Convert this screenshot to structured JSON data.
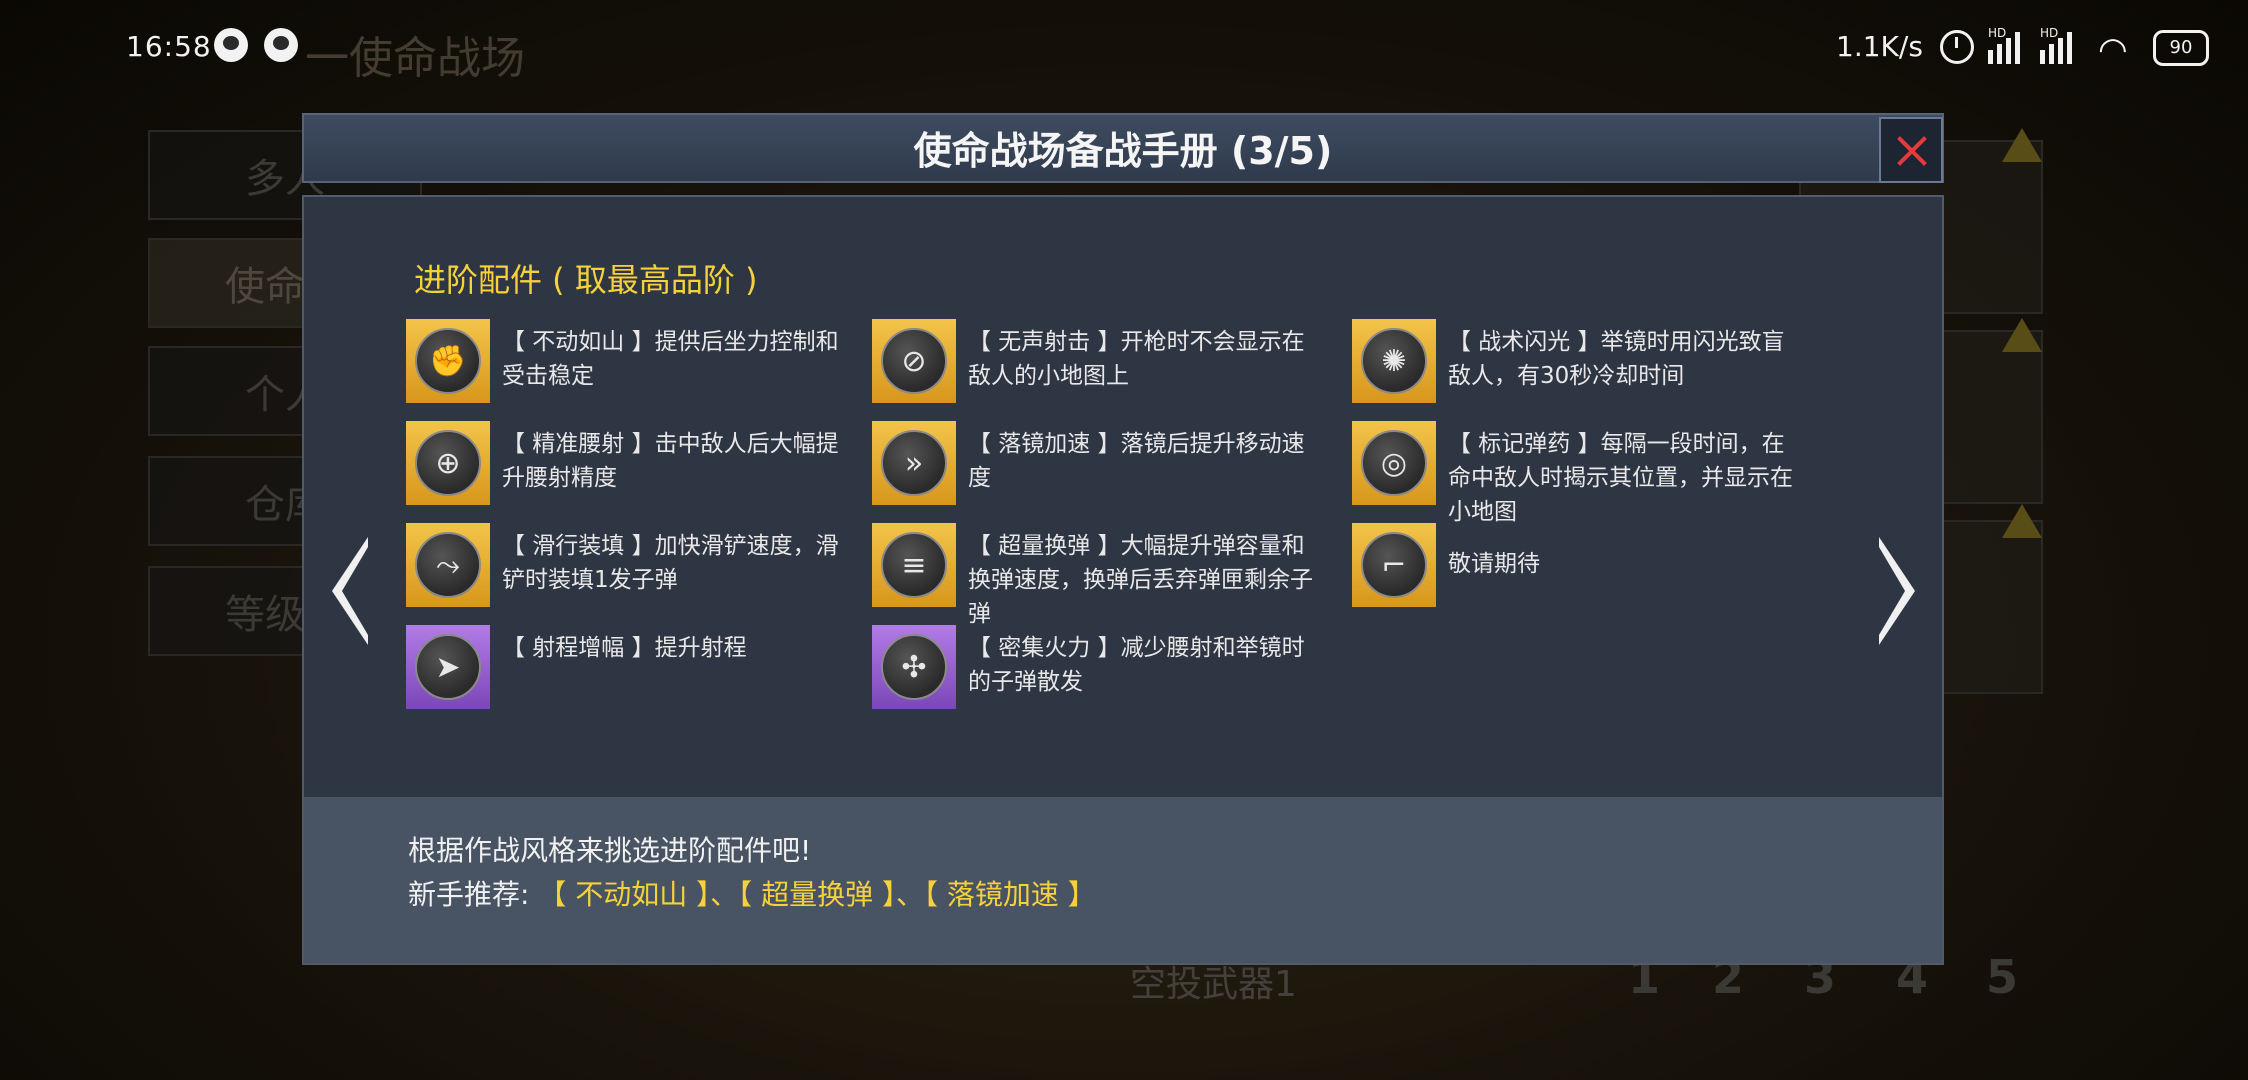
{
  "status_bar": {
    "time": "16:58",
    "net_speed": "1.1K/s",
    "signal1": "HD",
    "signal2": "HD",
    "battery": "90"
  },
  "background": {
    "title": "一使命战场",
    "side_items": [
      "多人",
      "使命战",
      "个人",
      "仓库",
      "等级解"
    ],
    "bottom_label": "空投武器1",
    "slots": [
      "1",
      "2",
      "3",
      "4",
      "5"
    ]
  },
  "dialog": {
    "title": "使命战场备战手册 (3/5)",
    "section_title": "进阶配件 ( 取最高品阶 )",
    "items": [
      {
        "text": "【 不动如山 】提供后坐力控制和受击稳定",
        "tier": "gold",
        "icon": "arm-shield-icon"
      },
      {
        "text": "【 无声射击 】开枪时不会显示在敌人的小地图上",
        "tier": "gold",
        "icon": "silencer-icon"
      },
      {
        "text": "【 战术闪光 】举镜时用闪光致盲敌人，有30秒冷却时间",
        "tier": "gold",
        "icon": "flash-icon"
      },
      {
        "text": "【 精准腰射 】击中敌人后大幅提升腰射精度",
        "tier": "gold",
        "icon": "crosshair-icon"
      },
      {
        "text": "【 落镜加速 】落镜后提升移动速度",
        "tier": "gold",
        "icon": "sprint-icon"
      },
      {
        "text": "【 标记弹药 】每隔一段时间，在命中敌人时揭示其位置，并显示在小地图",
        "tier": "gold",
        "icon": "radar-icon"
      },
      {
        "text": "【 滑行装填 】加快滑铲速度，滑铲时装填1发子弹",
        "tier": "gold",
        "icon": "slide-icon"
      },
      {
        "text": "【 超量换弹 】大幅提升弹容量和换弹速度，换弹后丢弃弹匣剩余子弹",
        "tier": "gold",
        "icon": "magazine-icon"
      },
      {
        "text": "敬请期待",
        "tier": "gold",
        "icon": "gun-icon"
      },
      {
        "text": "【 射程增幅 】提升射程",
        "tier": "purple",
        "icon": "bullet-icon"
      },
      {
        "text": "【 密集火力 】减少腰射和举镜时的子弹散发",
        "tier": "purple",
        "icon": "converge-icon"
      }
    ],
    "footer_line1": "根据作战风格来挑选进阶配件吧!",
    "footer_prefix": "新手推荐:",
    "recommend": [
      "【 不动如山 】",
      "【 超量换弹 】",
      "【 落镜加速 】"
    ],
    "separator": "、"
  },
  "colors": {
    "accent": "#f5d23a",
    "gold_tier": "#e8b032",
    "purple_tier": "#9a63d0",
    "close_x": "#e23b3b"
  }
}
